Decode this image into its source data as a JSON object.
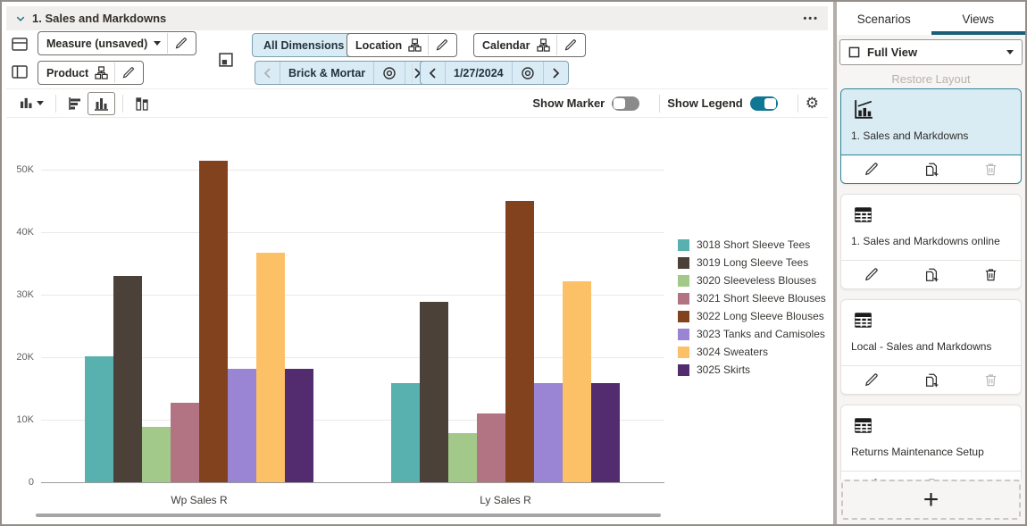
{
  "window": {
    "title": "1. Sales and Markdowns",
    "overflow_menu": "•••"
  },
  "toolbar": {
    "measure_button": "Measure (unsaved)",
    "product_button": "Product",
    "all_dimensions_button": "All Dimensions",
    "location_button": "Location",
    "calendar_button": "Calendar",
    "location_value": "Brick & Mortar",
    "calendar_value": "1/27/2024"
  },
  "chart_toolbar": {
    "show_marker_label": "Show Marker",
    "show_marker_on": false,
    "show_legend_label": "Show Legend",
    "show_legend_on": true
  },
  "chart_data": {
    "type": "bar",
    "title": "",
    "categories": [
      "Wp Sales R",
      "Ly Sales R"
    ],
    "series": [
      {
        "name": "3018 Short Sleeve Tees",
        "color": "#58b1ae",
        "values": [
          20100,
          15900
        ]
      },
      {
        "name": "3019 Long Sleeve Tees",
        "color": "#4b4139",
        "values": [
          33000,
          28800
        ]
      },
      {
        "name": "3020 Sleeveless Blouses",
        "color": "#a3c98a",
        "values": [
          8800,
          7800
        ]
      },
      {
        "name": "3021 Short Sleeve Blouses",
        "color": "#b27382",
        "values": [
          12700,
          11000
        ]
      },
      {
        "name": "3022 Long Sleeve Blouses",
        "color": "#83421e",
        "values": [
          51400,
          45000
        ]
      },
      {
        "name": "3023 Tanks and Camisoles",
        "color": "#9a84d4",
        "values": [
          18200,
          15900
        ]
      },
      {
        "name": "3024 Sweaters",
        "color": "#fcc067",
        "values": [
          36700,
          32100
        ]
      },
      {
        "name": "3025 Skirts",
        "color": "#522c6e",
        "values": [
          18200,
          15900
        ]
      }
    ],
    "ylabel": "",
    "xlabel": "",
    "ylim": [
      0,
      50000
    ],
    "yticks": [
      "0",
      "10K",
      "20K",
      "30K",
      "40K",
      "50K"
    ],
    "grid": true,
    "legend_position": "right"
  },
  "sidebar": {
    "tabs": [
      {
        "label": "Scenarios",
        "active": false
      },
      {
        "label": "Views",
        "active": true
      }
    ],
    "view_selector": "Full View",
    "restore_layout_label": "Restore Layout",
    "cards": [
      {
        "label": "1. Sales and Markdowns",
        "icon": "chart",
        "selected": true,
        "delete_enabled": false
      },
      {
        "label": "1. Sales and Markdowns online",
        "icon": "table",
        "selected": false,
        "delete_enabled": true
      },
      {
        "label": "Local - Sales and Markdowns",
        "icon": "table",
        "selected": false,
        "delete_enabled": false
      },
      {
        "label": "Returns Maintenance Setup",
        "icon": "table",
        "selected": false,
        "delete_enabled": true
      }
    ],
    "add_button_label": "+"
  },
  "colors": {
    "accent_teal": "#0f7694",
    "tab_underline": "#1a5d77",
    "selected_card_bg": "#d9ecf4",
    "button_blue_bg": "#d9ecf6",
    "header_bg": "#f1efed"
  }
}
